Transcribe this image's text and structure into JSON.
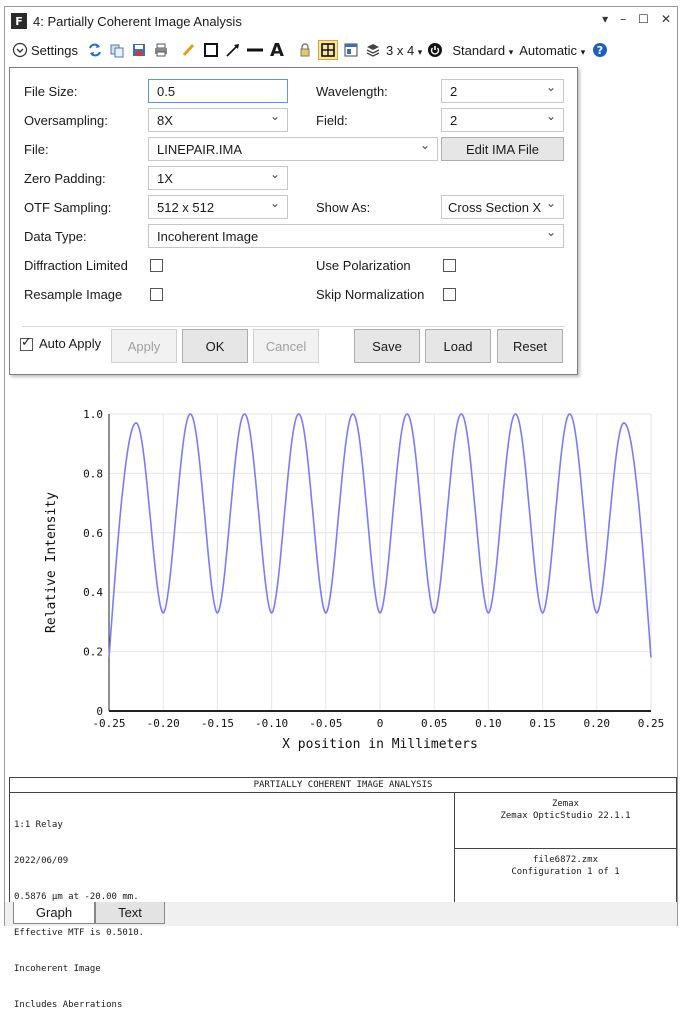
{
  "window": {
    "title": "4: Partially Coherent Image Analysis",
    "app_icon": "F"
  },
  "toolbar": {
    "settings_label": "Settings",
    "layout_label": "3 x 4",
    "standard_label": "Standard",
    "automatic_label": "Automatic"
  },
  "settings": {
    "file_size_label": "File Size:",
    "file_size_value": "0.5",
    "wavelength_label": "Wavelength:",
    "wavelength_value": "2",
    "oversampling_label": "Oversampling:",
    "oversampling_value": "8X",
    "field_label": "Field:",
    "field_value": "2",
    "file_label": "File:",
    "file_value": "LINEPAIR.IMA",
    "edit_ima_label": "Edit IMA File",
    "zero_padding_label": "Zero Padding:",
    "zero_padding_value": "1X",
    "otf_sampling_label": "OTF Sampling:",
    "otf_sampling_value": "512 x 512",
    "show_as_label": "Show As:",
    "show_as_value": "Cross Section X",
    "data_type_label": "Data Type:",
    "data_type_value": "Incoherent Image",
    "diffraction_limited_label": "Diffraction Limited",
    "use_polarization_label": "Use Polarization",
    "resample_image_label": "Resample Image",
    "skip_normalization_label": "Skip Normalization",
    "auto_apply_label": "Auto Apply",
    "apply_label": "Apply",
    "ok_label": "OK",
    "cancel_label": "Cancel",
    "save_label": "Save",
    "load_label": "Load",
    "reset_label": "Reset"
  },
  "chart_data": {
    "type": "line",
    "xlabel": "X position in Millimeters",
    "ylabel": "Relative Intensity",
    "xlim": [
      -0.25,
      0.25
    ],
    "ylim": [
      0,
      1.0
    ],
    "x_ticks": [
      "-0.25",
      "-0.20",
      "-0.15",
      "-0.10",
      "-0.05",
      "0",
      "0.05",
      "0.10",
      "0.15",
      "0.20",
      "0.25"
    ],
    "y_ticks": [
      "0",
      "0.2",
      "0.4",
      "0.6",
      "0.8",
      "1.0"
    ],
    "series": [
      {
        "color": "#7b7bff",
        "x": [
          -0.25,
          -0.225,
          -0.2,
          -0.175,
          -0.15,
          -0.125,
          -0.1,
          -0.075,
          -0.05,
          -0.025,
          0,
          0.025,
          0.05,
          0.075,
          0.1,
          0.125,
          0.15,
          0.175,
          0.2,
          0.225,
          0.25
        ],
        "y": [
          0.18,
          0.97,
          0.33,
          1.0,
          0.33,
          1.0,
          0.33,
          1.0,
          0.33,
          1.0,
          0.33,
          1.0,
          0.33,
          1.0,
          0.33,
          1.0,
          0.33,
          1.0,
          0.33,
          0.97,
          0.18
        ],
        "peaks_x": [
          -0.225,
          -0.175,
          -0.125,
          -0.075,
          -0.025,
          0.025,
          0.075,
          0.125,
          0.175,
          0.225
        ],
        "peaks_y": [
          0.97,
          1.0,
          1.0,
          1.0,
          1.0,
          1.0,
          1.0,
          1.0,
          1.0,
          0.97
        ],
        "troughs_y": 0.33,
        "edge_y": 0.18
      }
    ]
  },
  "info": {
    "header": "PARTIALLY COHERENT IMAGE ANALYSIS",
    "lines": [
      "1:1 Relay",
      "2022/06/09",
      "0.5876 µm at -20.00 mm.",
      "Effective MTF is 0.5010.",
      "Incoherent Image",
      "Includes Aberrations"
    ],
    "company": "Zemax",
    "product": "Zemax OpticStudio 22.1.1",
    "file": "file6872.zmx",
    "configuration": "Configuration 1 of 1"
  },
  "tabs": {
    "graph_label": "Graph",
    "text_label": "Text"
  }
}
